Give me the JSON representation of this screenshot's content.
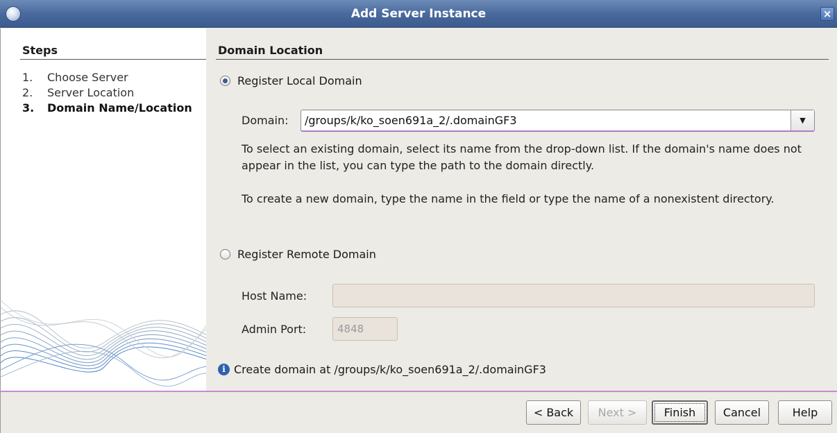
{
  "window": {
    "title": "Add Server Instance",
    "close_glyph": "×"
  },
  "steps": {
    "header": "Steps",
    "items": [
      {
        "num": "1.",
        "label": "Choose Server"
      },
      {
        "num": "2.",
        "label": "Server Location"
      },
      {
        "num": "3.",
        "label": "Domain Name/Location",
        "current": true
      }
    ]
  },
  "domain_location": {
    "title": "Domain Location",
    "local": {
      "label": "Register Local Domain",
      "checked": true,
      "domain_label": "Domain:",
      "domain_value": "/groups/k/ko_soen691a_2/.domainGF3",
      "help_1": "To select an existing domain, select its name from the drop-down list. If the domain's name does not appear in the list, you can type the path to the domain directly.",
      "help_2": "To create a new domain, type the name in the field or type the name of a nonexistent directory."
    },
    "remote": {
      "label": "Register Remote Domain",
      "checked": false,
      "host_label": "Host Name:",
      "host_value": "",
      "port_label": "Admin Port:",
      "port_value": "4848"
    },
    "info": "Create domain at /groups/k/ko_soen691a_2/.domainGF3"
  },
  "buttons": {
    "back": "< Back",
    "next": "Next >",
    "finish": "Finish",
    "cancel": "Cancel",
    "help": "Help"
  },
  "icons": {
    "app": "glassfish-app-icon",
    "close": "close-icon",
    "info": "info-icon",
    "dropdown": "chevron-down-icon"
  },
  "colors": {
    "titlebar": "#4a6a9e",
    "accent_separator": "#c98acf",
    "disabled_field": "#e9e3dc"
  }
}
